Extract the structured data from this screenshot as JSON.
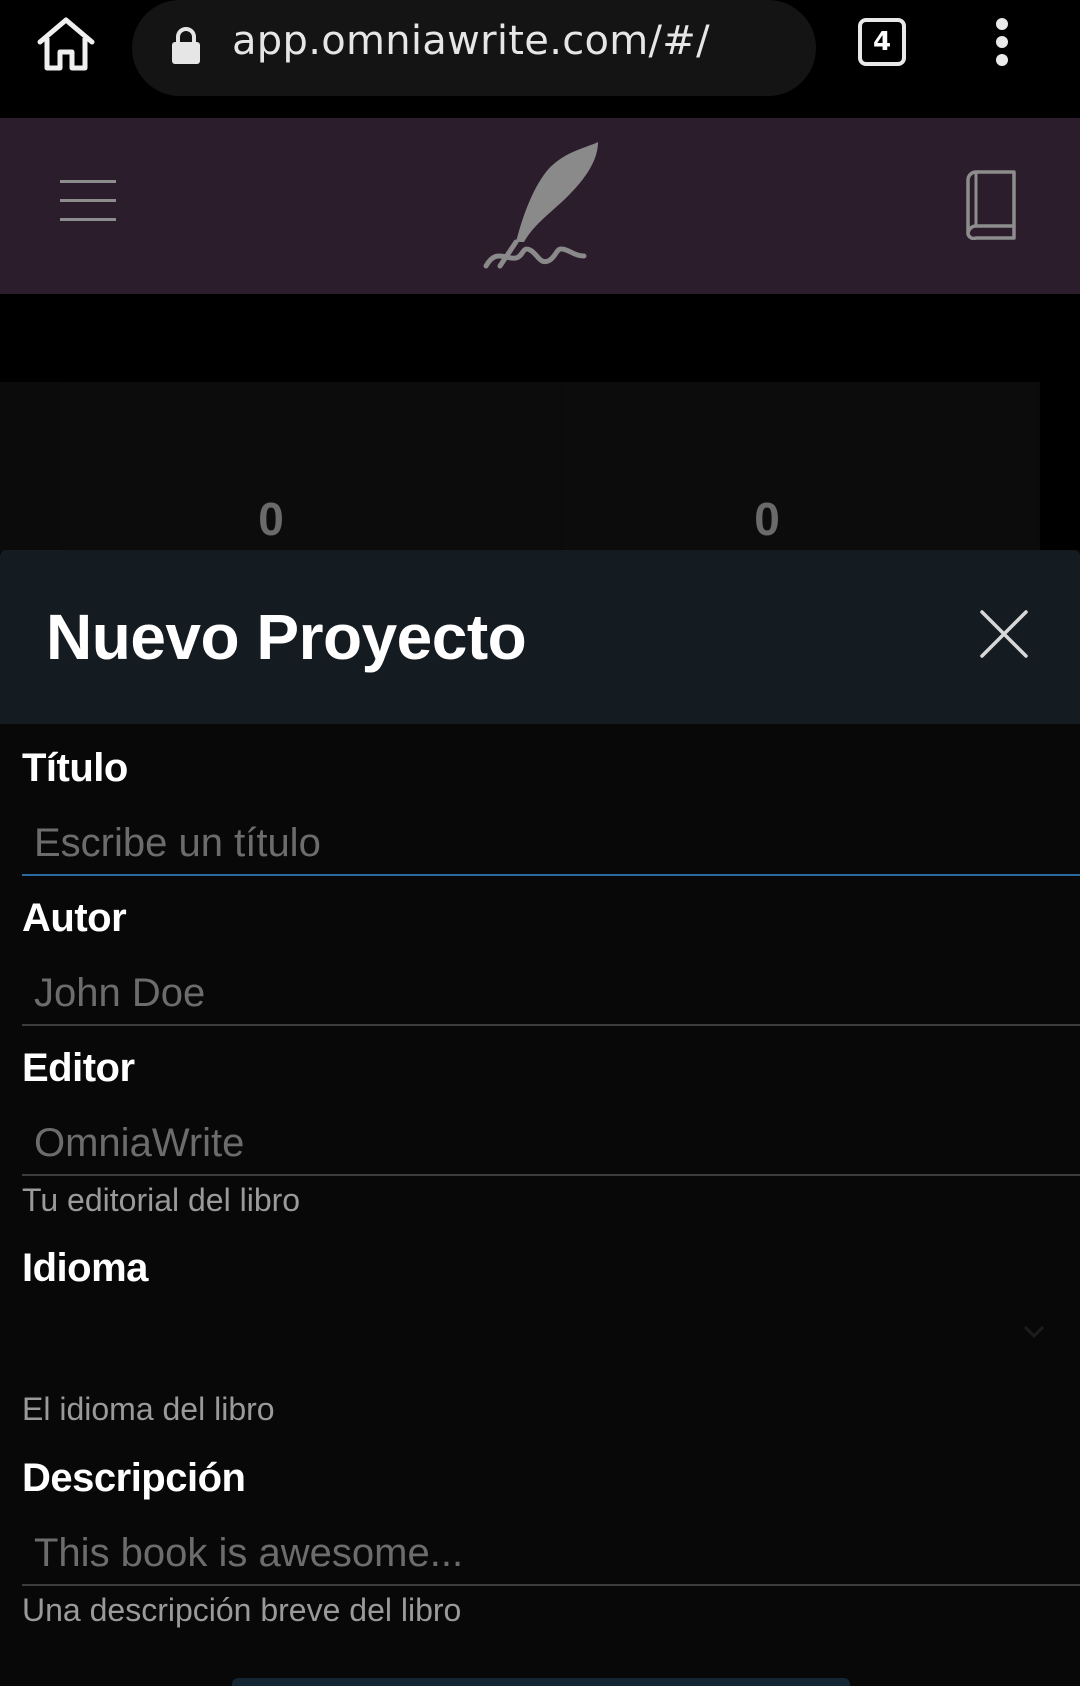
{
  "browser": {
    "url": "app.omniawrite.com/#/",
    "tab_count": "4",
    "icons": {
      "home": "home-icon",
      "lock": "lock-icon",
      "menu": "vertical-dots-icon"
    }
  },
  "app_header": {
    "icons": {
      "menu": "hamburger-icon",
      "logo": "quill-icon",
      "library": "book-icon"
    }
  },
  "stats": {
    "first_value": "0",
    "second_value": "0"
  },
  "modal": {
    "title": "Nuevo Proyecto",
    "fields": {
      "title": {
        "label": "Título",
        "placeholder": "Escribe un título"
      },
      "author": {
        "label": "Autor",
        "placeholder": "John Doe"
      },
      "publisher": {
        "label": "Editor",
        "placeholder": "OmniaWrite",
        "help": "Tu editorial del libro"
      },
      "language": {
        "label": "Idioma",
        "value": "",
        "help": "El idioma del libro"
      },
      "description": {
        "label": "Descripción",
        "placeholder": "This book is awesome...",
        "help": "Una descripción breve del libro"
      }
    }
  },
  "colors": {
    "header_bg": "#2b1d2b",
    "modal_header_bg": "#151c21",
    "active_underline": "#2a6aa0",
    "page_bg": "#080808"
  }
}
